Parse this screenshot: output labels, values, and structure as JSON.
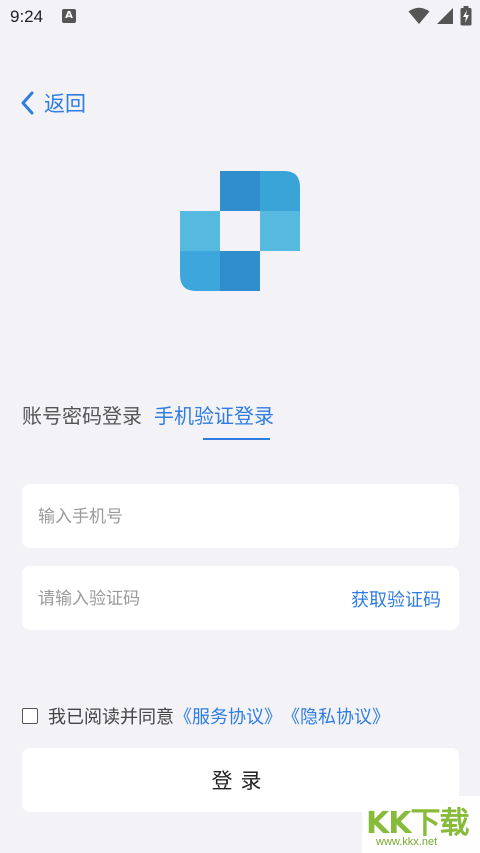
{
  "status_bar": {
    "time": "9:24",
    "notification_icon_label": "A",
    "icons": [
      "wifi-icon",
      "signal-icon",
      "battery-charging-icon"
    ]
  },
  "nav": {
    "back_label": "返回"
  },
  "logo": {
    "colors": [
      "#2f8ecb",
      "#3aa3d8",
      "#55b9e0",
      "#3da6dc",
      "#2f8ecb"
    ]
  },
  "tabs": [
    {
      "label": "账号密码登录",
      "active": false
    },
    {
      "label": "手机验证登录",
      "active": true
    }
  ],
  "form": {
    "phone_placeholder": "输入手机号",
    "code_placeholder": "请输入验证码",
    "get_code_label": "获取验证码"
  },
  "agreement": {
    "text": "我已阅读并同意",
    "service_link": "《服务协议》",
    "privacy_link": "《隐私协议》",
    "checked": false
  },
  "login_button_label": "登录",
  "watermark": {
    "main": "KK下载",
    "sub": "www.kkx.net"
  },
  "colors": {
    "accent": "#2f7de1",
    "background": "#f2f2f7"
  }
}
